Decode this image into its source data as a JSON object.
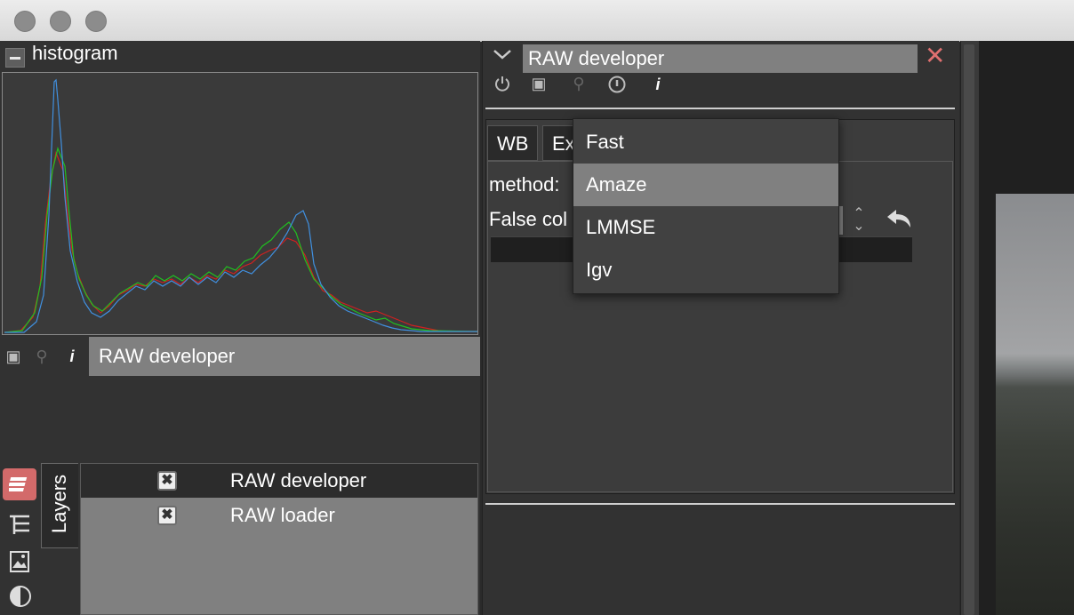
{
  "window": {
    "traffic_lights": [
      "close",
      "minimize",
      "zoom"
    ]
  },
  "histogram": {
    "title": "histogram",
    "collapse_icon": "minus-icon"
  },
  "left_module": {
    "label": "RAW developer",
    "icons": [
      "camera-icon",
      "pin-icon",
      "info-icon"
    ]
  },
  "side_tabs": {
    "items": [
      "layers-icon",
      "tree-icon",
      "image-icon",
      "contrast-icon"
    ],
    "active_tab_label": "Layers"
  },
  "layers": [
    {
      "name": "RAW developer",
      "enabled": true,
      "selected": true
    },
    {
      "name": "RAW loader",
      "enabled": true,
      "selected": false
    }
  ],
  "module_panel": {
    "title": "RAW developer",
    "close_icon": "close-icon",
    "toolbar_icons": [
      "power-icon",
      "camera-icon",
      "pin-icon",
      "reset-icon",
      "info-icon"
    ],
    "tabs": [
      "WB",
      "Ex"
    ],
    "method_label": "method:",
    "false_color_label": "False col"
  },
  "dropdown": {
    "options": [
      "Fast",
      "Amaze",
      "LMMSE",
      "Igv"
    ],
    "selected": "Amaze"
  },
  "colors": {
    "accent_close": "#e07070",
    "selected_bg": "#808080",
    "panel_bg": "#323232"
  }
}
